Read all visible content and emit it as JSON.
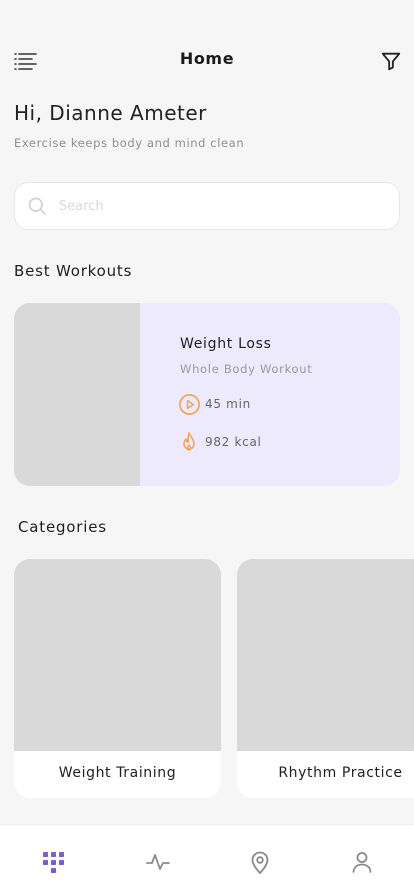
{
  "header": {
    "title": "Home",
    "menu_icon": "menu-lines-icon",
    "filter_icon": "filter-funnel-icon"
  },
  "greeting": {
    "title": "Hi, Dianne Ameter",
    "subtitle": "Exercise keeps body and mind clean"
  },
  "search": {
    "placeholder": "Search",
    "value": "",
    "icon": "search-icon"
  },
  "best_workouts": {
    "title": "Best Workouts",
    "items": [
      {
        "name": "Weight Loss",
        "subtitle": "Whole Body Workout",
        "duration": "45 min",
        "calories": "982 kcal"
      }
    ]
  },
  "categories": {
    "title": "Categories",
    "items": [
      {
        "label": "Weight Training"
      },
      {
        "label": "Rhythm Practice"
      }
    ]
  },
  "bottom_nav": {
    "items": [
      {
        "icon": "grid-icon",
        "active": true
      },
      {
        "icon": "activity-icon",
        "active": false
      },
      {
        "icon": "location-pin-icon",
        "active": false
      },
      {
        "icon": "profile-icon",
        "active": false
      }
    ]
  },
  "colors": {
    "background": "#f6f6f6",
    "accent": "#7b5fc7",
    "card_tint": "#edeafd",
    "stat_icon": "#f5a35c",
    "placeholder_image": "#d9d9d9"
  }
}
